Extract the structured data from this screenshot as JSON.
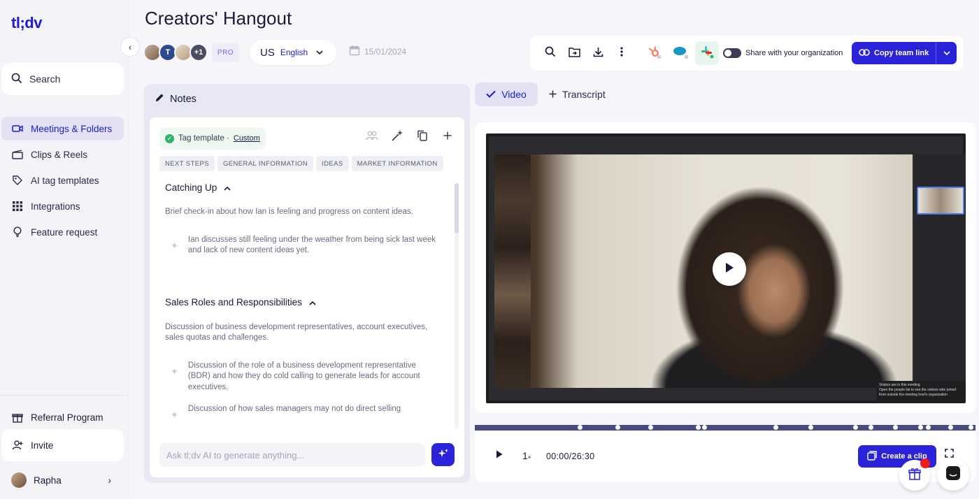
{
  "app": {
    "logo": "tl;dv"
  },
  "sidebar": {
    "search_label": "Search",
    "items": [
      {
        "label": "Meetings & Folders",
        "icon": "video-camera-icon",
        "active": true
      },
      {
        "label": "Clips & Reels",
        "icon": "clapperboard-icon",
        "active": false
      },
      {
        "label": "AI tag templates",
        "icon": "tag-icon",
        "active": false
      },
      {
        "label": "Integrations",
        "icon": "grid-icon",
        "active": false
      },
      {
        "label": "Feature request",
        "icon": "lightbulb-icon",
        "active": false
      }
    ],
    "referral_label": "Referral Program",
    "invite_label": "Invite",
    "user_name": "Rapha"
  },
  "header": {
    "title": "Creators' Hangout",
    "participant_initial": "T",
    "participant_more": "+1",
    "plan_badge": "PRO",
    "language_flag": "US",
    "language_name": "English",
    "date": "15/01/2024"
  },
  "toolbar": {
    "share_label": "Share with your organization",
    "copy_link_label": "Copy team link"
  },
  "notes": {
    "title": "Notes",
    "tag_template_label": "Tag template ·",
    "tag_template_value": "Custom",
    "tags": [
      "NEXT STEPS",
      "GENERAL INFORMATION",
      "IDEAS",
      "MARKET INFORMATION"
    ],
    "topics": [
      {
        "title": "Catching Up",
        "summary": "Brief check-in about how Ian is feeling and progress on content ideas.",
        "points": [
          "Ian discusses still feeling under the weather from being sick last week and lack of new content ideas yet."
        ]
      },
      {
        "title": "Sales Roles and Responsibilities",
        "summary": "Discussion of business development representatives, account executives, sales quotas and challenges.",
        "points": [
          "Discussion of the role of a business development representative (BDR) and how they do cold calling to generate leads for account executives.",
          "Discussion of how sales managers may not do direct selling"
        ]
      }
    ],
    "ask_placeholder": "Ask tl;dv AI to generate anything..."
  },
  "video": {
    "tab_video": "Video",
    "tab_transcript": "Transcript",
    "visitors_title": "Visitors are in this meeting",
    "visitors_text": "Open the people list to see the visitors who joined from outside the meeting host's organization",
    "speed_value": "1",
    "speed_unit": "×",
    "time": "00:00/26:30",
    "create_clip_label": "Create a clip",
    "timeline_markers": [
      0.21,
      0.285,
      0.35,
      0.445,
      0.458,
      0.6,
      0.67,
      0.76,
      0.79,
      0.84,
      0.89,
      0.905,
      0.95,
      0.99
    ]
  },
  "colors": {
    "brand": "#2b23d9",
    "accent_bg": "#e2e2f4",
    "timeline": "#4a4a7c"
  }
}
